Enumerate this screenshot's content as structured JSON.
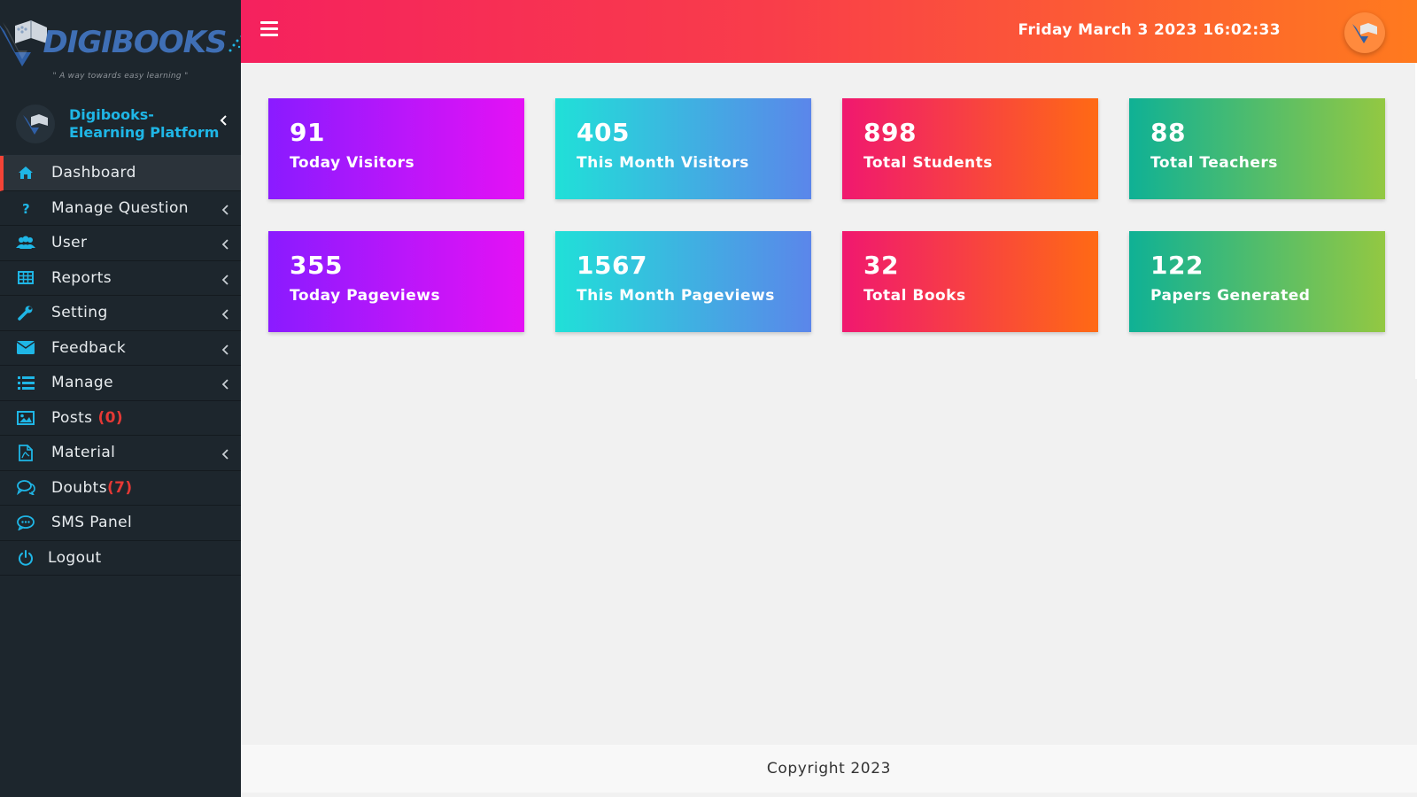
{
  "brand": {
    "name": "DIGIBOOKS",
    "tagline": "\" A way towards easy learning \""
  },
  "profile": {
    "line1": "Digibooks-",
    "line2": "Elearning Platform",
    "toggle_icon": "chevron-left-icon"
  },
  "menu": [
    {
      "label": "Dashboard",
      "icon": "home-icon",
      "active": true
    },
    {
      "label": "Manage Question",
      "icon": "question-icon",
      "chevron": true
    },
    {
      "label": "User",
      "icon": "users-icon",
      "chevron": true
    },
    {
      "label": "Reports",
      "icon": "table-icon",
      "chevron": true
    },
    {
      "label": "Setting",
      "icon": "wrench-icon",
      "chevron": true
    },
    {
      "label": "Feedback",
      "icon": "envelope-icon",
      "chevron": true
    },
    {
      "label": "Manage",
      "icon": "list-icon",
      "chevron": true
    },
    {
      "label": "Posts",
      "count": "(0)",
      "icon": "image-icon"
    },
    {
      "label": "Material",
      "icon": "pdf-file-icon",
      "chevron": true
    },
    {
      "label": "Doubts",
      "count": "(7)",
      "icon": "comments-icon"
    },
    {
      "label": "SMS Panel",
      "icon": "sms-icon"
    },
    {
      "label": "Logout",
      "icon": "power-icon"
    }
  ],
  "header": {
    "datetime": "Friday March 3 2023 16:02:33",
    "menu_icon": "hamburger-icon"
  },
  "stats": [
    {
      "value": "91",
      "label": "Today Visitors"
    },
    {
      "value": "405",
      "label": "This Month Visitors"
    },
    {
      "value": "898",
      "label": "Total Students"
    },
    {
      "value": "88",
      "label": "Total Teachers"
    },
    {
      "value": "355",
      "label": "Today Pageviews"
    },
    {
      "value": "1567",
      "label": "This Month Pageviews"
    },
    {
      "value": "32",
      "label": "Total Books"
    },
    {
      "value": "122",
      "label": "Papers Generated"
    }
  ],
  "footer": {
    "copyright": "Copyright 2023"
  },
  "colors": {
    "sidebar_bg": "#1d262d",
    "accent_cyan": "#1fb6e6",
    "active_marker": "#f44336",
    "count_red": "#e53935"
  }
}
